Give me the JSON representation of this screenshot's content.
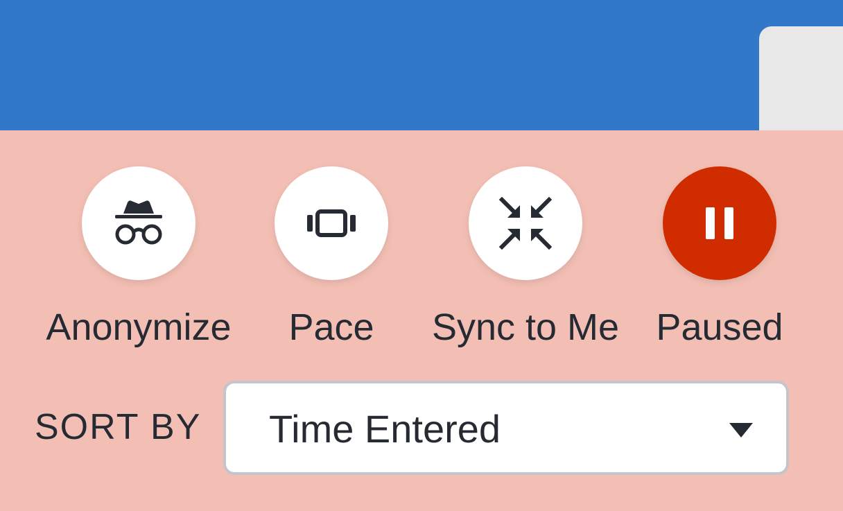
{
  "colors": {
    "header_blue": "#3178c8",
    "panel_background": "#f3bfb4",
    "active_red": "#d12c00",
    "text_dark": "#262a33"
  },
  "controls": [
    {
      "label": "Anonymize",
      "icon": "incognito-icon",
      "active": false
    },
    {
      "label": "Pace",
      "icon": "carousel-icon",
      "active": false
    },
    {
      "label": "Sync to Me",
      "icon": "collapse-arrows-icon",
      "active": false
    },
    {
      "label": "Paused",
      "icon": "pause-icon",
      "active": true
    }
  ],
  "sort": {
    "label": "SORT BY",
    "selected": "Time Entered"
  }
}
